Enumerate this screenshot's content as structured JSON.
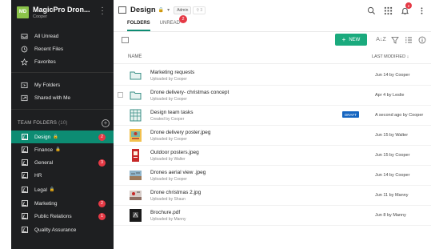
{
  "brand": {
    "logo_text": "MD",
    "name": "MagicPro Dron...",
    "subtitle": "Cooper"
  },
  "sidebar": {
    "top_items": [
      {
        "label": "All Unread",
        "icon": "inbox-icon"
      },
      {
        "label": "Recent Files",
        "icon": "clock-icon"
      },
      {
        "label": "Favorites",
        "icon": "star-icon"
      }
    ],
    "folder_items": [
      {
        "label": "My Folders",
        "icon": "folder-icon"
      },
      {
        "label": "Shared with Me",
        "icon": "shared-icon"
      }
    ],
    "team_header": {
      "label": "TEAM FOLDERS",
      "count": "(10)"
    },
    "team_folders": [
      {
        "label": "Design",
        "locked": "🔒",
        "badge": "2",
        "active": true
      },
      {
        "label": "Finance",
        "locked": "🔒",
        "badge": ""
      },
      {
        "label": "General",
        "locked": "",
        "badge": "3"
      },
      {
        "label": "HR",
        "locked": "",
        "badge": ""
      },
      {
        "label": "Legal",
        "locked": "🔒",
        "badge": ""
      },
      {
        "label": "Marketing",
        "locked": "",
        "badge": "2"
      },
      {
        "label": "Public Relations",
        "locked": "",
        "badge": "1"
      },
      {
        "label": "Quality Assurance",
        "locked": "",
        "badge": ""
      }
    ]
  },
  "header": {
    "title": "Design",
    "lock": "🔒",
    "chevron": "▾",
    "role": "Admin",
    "role_extra": "⚲ 3",
    "tabs": [
      {
        "label": "FOLDERS",
        "active": true
      },
      {
        "label": "UNREAD",
        "badge": "2"
      }
    ],
    "notification_count": "2"
  },
  "toolbar": {
    "new_label": "NEW",
    "new_plus": "+",
    "sort_label": "A↓Z"
  },
  "list": {
    "col_name": "NAME",
    "col_modified": "LAST MODIFIED ↓",
    "rows": [
      {
        "name": "Marketing requests",
        "sub": "Uploaded by Cooper",
        "modified": "Jun 14 by Cooper",
        "type": "folder"
      },
      {
        "name": "Drone delivery- christmas concept",
        "sub": "Uploaded by Cooper",
        "modified": "Apr 4 by Leslie",
        "type": "folder"
      },
      {
        "name": "Design team tasks",
        "sub": "Created by Cooper",
        "modified": "A second ago by Cooper",
        "type": "sheet",
        "tag": "DRAFT"
      },
      {
        "name": "Drone delivery poster.jpeg",
        "sub": "Uploaded by Cooper",
        "modified": "Jun 15 by Walter",
        "type": "image-poster"
      },
      {
        "name": "Outdoor posters.jpeg",
        "sub": "Uploaded by Walter",
        "modified": "Jun 15 by Cooper",
        "type": "image-red"
      },
      {
        "name": "Drones aerial view .jpeg",
        "sub": "Uploaded by Cooper",
        "modified": "Jun 14 by Cooper",
        "type": "image-aerial"
      },
      {
        "name": "Drone christmas 2.jpg",
        "sub": "Uploaded by Shaun",
        "modified": "Jun 11 by Manny",
        "type": "image-xmas"
      },
      {
        "name": "Brochure.pdf",
        "sub": "Uploaded by Manny",
        "modified": "Jun 8 by Manny",
        "type": "pdf"
      }
    ]
  },
  "colors": {
    "sidebar_bg": "#1e1f21",
    "accent": "#0d8c73",
    "new_button": "#1aaa7d",
    "badge": "#e53945",
    "draft": "#1565c0"
  }
}
